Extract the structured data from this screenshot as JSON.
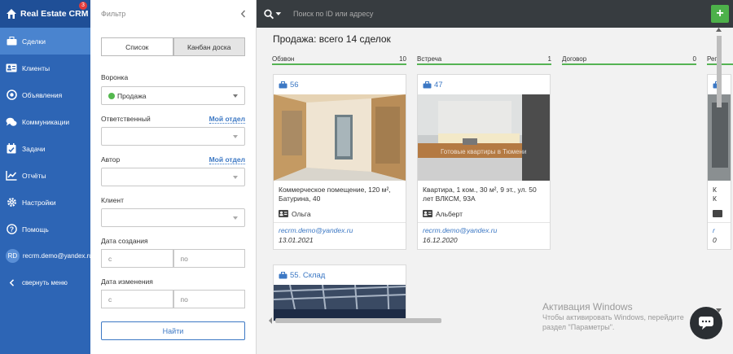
{
  "app": {
    "name": "Real Estate CRM",
    "badge": "3"
  },
  "sidebar": {
    "items": [
      {
        "label": "Сделки",
        "icon": "briefcase-icon",
        "active": true
      },
      {
        "label": "Клиенты",
        "icon": "contact-card-icon"
      },
      {
        "label": "Объявления",
        "icon": "target-icon"
      },
      {
        "label": "Коммуникации",
        "icon": "chat-bubbles-icon"
      },
      {
        "label": "Задачи",
        "icon": "calendar-check-icon"
      },
      {
        "label": "Отчёты",
        "icon": "line-chart-icon"
      },
      {
        "label": "Настройки",
        "icon": "gear-icon"
      },
      {
        "label": "Помощь",
        "icon": "question-icon"
      }
    ],
    "user": {
      "initials": "RD",
      "email": "recrm.demo@yandex.ru"
    },
    "collapse_label": "свернуть меню"
  },
  "filter": {
    "title": "Фильтр",
    "view_list": "Список",
    "view_kanban": "Канбан доска",
    "funnel_label": "Воронка",
    "funnel_value": "Продажа",
    "responsible_label": "Ответственный",
    "responsible_link": "Мой отдел",
    "author_label": "Автор",
    "author_link": "Мой отдел",
    "client_label": "Клиент",
    "created_label": "Дата создания",
    "changed_label": "Дата изменения",
    "from_placeholder": "с",
    "to_placeholder": "по",
    "find_button": "Найти"
  },
  "topbar": {
    "search_placeholder": "Поиск по ID или адресу",
    "add_label": "+"
  },
  "main": {
    "title": "Продажа: всего 14 сделок",
    "columns": [
      {
        "name": "Обзвон",
        "count": "10"
      },
      {
        "name": "Встреча",
        "count": "1"
      },
      {
        "name": "Договор",
        "count": "0"
      },
      {
        "name": "Рег",
        "count": ""
      }
    ],
    "cards": [
      {
        "id": "56",
        "desc": "Коммерческое помещение, 120 м², Батурина, 40",
        "agent": "Ольга",
        "email": "recrm.demo@yandex.ru",
        "date": "13.01.2021"
      },
      {
        "id": "47",
        "desc": "Квартира, 1 ком., 30 м², 9 эт., ул. 50 лет ВЛКСМ, 93А",
        "agent": "Альберт",
        "email": "recrm.demo@yandex.ru",
        "date": "16.12.2020",
        "watermark": "Готовые квартиры в Тюмени"
      },
      {
        "id": "55. Склад"
      },
      {
        "id": "",
        "desc": "К\nК",
        "email": "r",
        "date": "0"
      }
    ]
  },
  "windows": {
    "line1": "Активация Windows",
    "line2": "Чтобы активировать Windows, перейдите",
    "line3": "раздел \"Параметры\"."
  },
  "colors": {
    "sidebar": "#2d65b5",
    "accent": "#3c78c4",
    "green": "#4db14a",
    "topbar": "#373c40"
  }
}
